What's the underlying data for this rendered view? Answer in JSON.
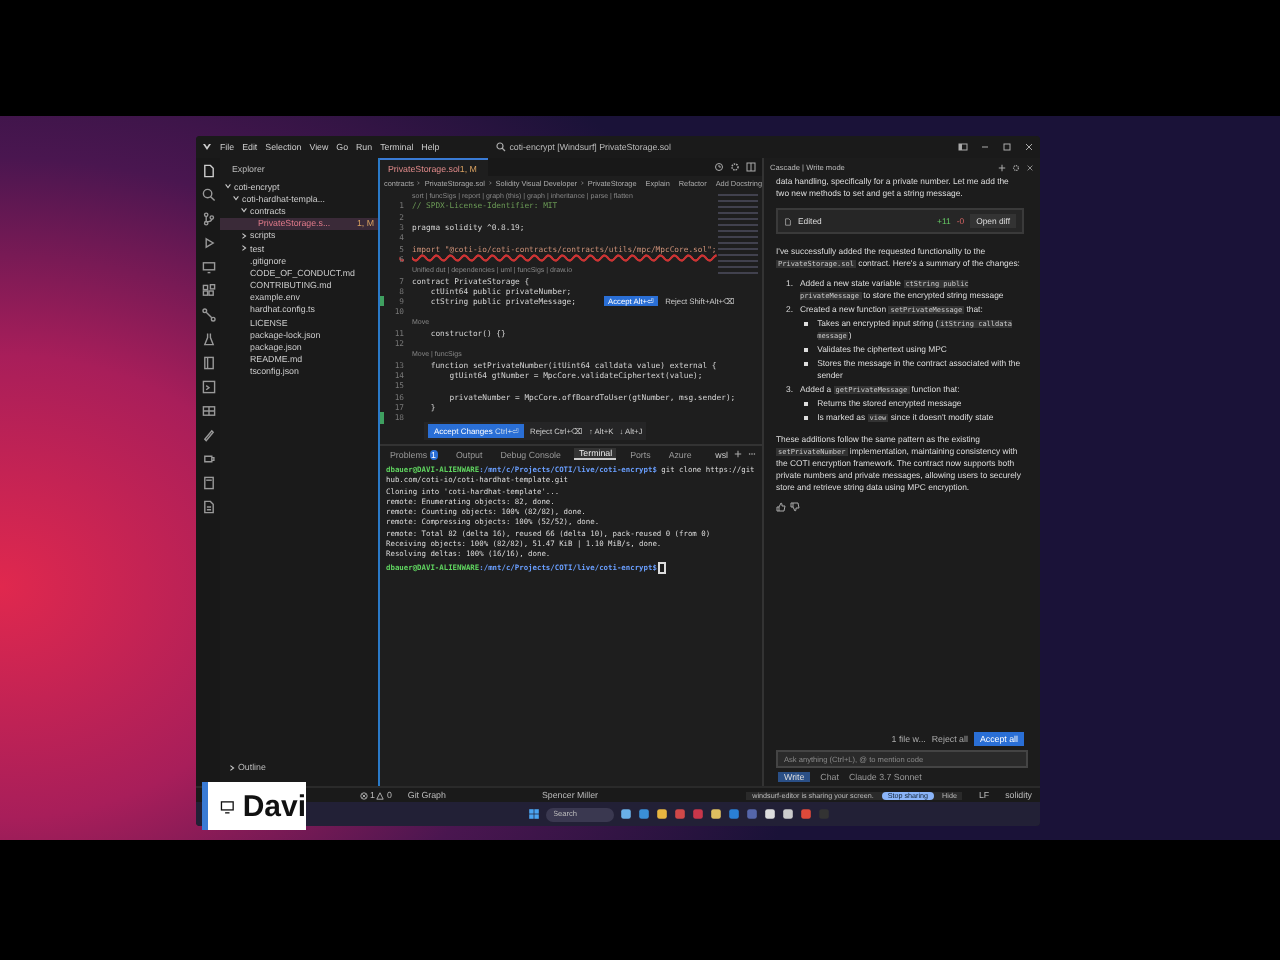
{
  "menu": [
    "File",
    "Edit",
    "Selection",
    "View",
    "Go",
    "Run",
    "Terminal",
    "Help"
  ],
  "command_center": "coti-encrypt [Windsurf] PrivateStorage.sol",
  "explorer": {
    "title": "Explorer",
    "tree": [
      {
        "label": "coti-encrypt",
        "expanded": true,
        "children": [
          {
            "label": "coti-hardhat-templa...",
            "expanded": true,
            "children": [
              {
                "label": "contracts",
                "expanded": true,
                "children": [
                  {
                    "label": "PrivateStorage.s...",
                    "badge": "1, M",
                    "selected": true
                  }
                ]
              },
              {
                "label": "scripts",
                "expanded": false
              },
              {
                "label": "test",
                "expanded": false
              },
              {
                "label": ".gitignore",
                "selected": false
              },
              {
                "label": "CODE_OF_CONDUCT.md",
                "selected": false
              },
              {
                "label": "CONTRIBUTING.md",
                "selected": false
              },
              {
                "label": "example.env",
                "selected": false
              },
              {
                "label": "hardhat.config.ts",
                "selected": false
              },
              {
                "label": "LICENSE",
                "selected": false
              },
              {
                "label": "package-lock.json",
                "selected": false
              },
              {
                "label": "package.json",
                "selected": false
              },
              {
                "label": "README.md",
                "selected": false
              },
              {
                "label": "tsconfig.json",
                "selected": false
              }
            ]
          }
        ]
      }
    ],
    "outline": "Outline"
  },
  "editor": {
    "tab": {
      "label": "PrivateStorage.sol",
      "badge": "1, M"
    },
    "breadcrumbs": [
      "contracts",
      "PrivateStorage.sol",
      "Solidity Visual Developer",
      "PrivateStorage"
    ],
    "actions": [
      "Explain",
      "Refactor",
      "Add Docstring"
    ],
    "lines": [
      {
        "kind": "lens",
        "text": "sort | funcSigs | report | graph (this) | graph | inheritance | parse | flatten"
      },
      {
        "kind": "comment",
        "num": "1",
        "text": "// SPDX-License-Identifier: MIT"
      },
      {
        "kind": "code",
        "num": "2"
      },
      {
        "kind": "code",
        "num": "3",
        "text": "pragma solidity ^0.8.19;"
      },
      {
        "kind": "code",
        "num": "4"
      },
      {
        "kind": "import",
        "num": "5",
        "text": "import \"@coti-io/coti-contracts/contracts/utils/mpc/MpcCore.sol\";"
      },
      {
        "kind": "code",
        "num": "6"
      },
      {
        "kind": "lens",
        "text": "Unified dut | dependencies | uml | funcSigs | draw.io"
      },
      {
        "kind": "code",
        "num": "7",
        "text": "contract PrivateStorage {"
      },
      {
        "kind": "code",
        "num": "8",
        "text": "    ctUint64 public privateNumber;"
      },
      {
        "kind": "code",
        "num": "9",
        "text": "    ctString public privateMessage;",
        "added": true,
        "inline_actions": [
          "Accept Alt+⏎",
          "Reject Shift+Alt+⌫"
        ]
      },
      {
        "kind": "code",
        "num": "10"
      },
      {
        "kind": "lens",
        "text": "Move"
      },
      {
        "kind": "code",
        "num": "11",
        "text": "    constructor() {}"
      },
      {
        "kind": "code",
        "num": "12"
      },
      {
        "kind": "lens",
        "text": "Move | funcSigs"
      },
      {
        "kind": "code",
        "num": "13",
        "text": "    function setPrivateNumber(itUint64 calldata value) external {"
      },
      {
        "kind": "code",
        "num": "14",
        "text": "        gtUint64 gtNumber = MpcCore.validateCiphertext(value);"
      },
      {
        "kind": "code",
        "num": "15"
      },
      {
        "kind": "code",
        "num": "16",
        "text": "        privateNumber = MpcCore.offBoardToUser(gtNumber, msg.sender);"
      },
      {
        "kind": "code",
        "num": "17",
        "text": "    }"
      },
      {
        "kind": "code",
        "num": "18",
        "added": true
      }
    ],
    "change_bar": {
      "accept": "Accept Changes",
      "accept_key": "Ctrl+⏎",
      "reject": "Reject Ctrl+⌫",
      "prev": "↑ Alt+K",
      "next": "↓ Alt+J"
    }
  },
  "panel": {
    "tabs": [
      {
        "label": "Problems",
        "badge": "1",
        "selected": false
      },
      {
        "label": "Output",
        "selected": false
      },
      {
        "label": "Debug Console",
        "selected": false
      },
      {
        "label": "Terminal",
        "selected": true
      },
      {
        "label": "Ports",
        "selected": false
      },
      {
        "label": "Azure",
        "selected": false
      }
    ],
    "shell": "wsl",
    "terminal": [
      {
        "kind": "prompt",
        "prompt": "dbauer@DAVI-ALIENWARE",
        "path": ":/mnt/c/Projects/COTI/live/coti-encrypt$",
        "command": " git clone https://github.com/coti-io/coti-hardhat-template.git"
      },
      {
        "kind": "out",
        "text": "Cloning into 'coti-hardhat-template'..."
      },
      {
        "kind": "out",
        "text": "remote: Enumerating objects: 82, done."
      },
      {
        "kind": "out",
        "text": "remote: Counting objects: 100% (82/82), done."
      },
      {
        "kind": "out",
        "text": "remote: Compressing objects: 100% (52/52), done."
      },
      {
        "kind": "out",
        "text": "remote: Total 82 (delta 16), reused 66 (delta 10), pack-reused 0 (from 0)"
      },
      {
        "kind": "out",
        "text": "Receiving objects: 100% (82/82), 51.47 KiB | 1.10 MiB/s, done."
      },
      {
        "kind": "out",
        "text": "Resolving deltas: 100% (16/16), done."
      },
      {
        "kind": "prompt",
        "prompt": "dbauer@DAVI-ALIENWARE",
        "path": ":/mnt/c/Projects/COTI/live/coti-encrypt$",
        "cursor": true
      }
    ]
  },
  "chat": {
    "title": "Cascade | Write mode",
    "blocks": [
      {
        "kind": "p",
        "parts": [
          {
            "text": "data handling, specifically for a private number. Let me add the two new methods to set and get a string message."
          }
        ]
      },
      {
        "kind": "edit",
        "label": "Edited",
        "added": "+11",
        "removed": "-0",
        "action": "Open diff"
      },
      {
        "kind": "p",
        "parts": [
          {
            "text": "I've successfully added the requested functionality to the "
          },
          {
            "text": "PrivateStorage.sol",
            "code": true
          },
          {
            "text": " contract. Here's a summary of the changes:"
          }
        ]
      },
      {
        "kind": "ol",
        "items": [
          {
            "number": "1.",
            "parts": [
              {
                "text": "Added a new state variable "
              },
              {
                "text": "ctString public privateMessage",
                "code": true
              },
              {
                "text": " to store the encrypted string message"
              }
            ]
          },
          {
            "number": "2.",
            "parts": [
              {
                "text": "Created a new function "
              },
              {
                "text": "setPrivateMessage",
                "code": true
              },
              {
                "text": " that:"
              }
            ],
            "children": [
              {
                "parts": [
                  {
                    "text": "Takes an encrypted input string ("
                  },
                  {
                    "text": "itString calldata message",
                    "code": true
                  },
                  {
                    "text": ")"
                  }
                ]
              },
              {
                "parts": [
                  {
                    "text": "Validates the ciphertext using MPC"
                  }
                ]
              },
              {
                "parts": [
                  {
                    "text": "Stores the message in the contract associated with the sender"
                  }
                ]
              }
            ]
          },
          {
            "number": "3.",
            "parts": [
              {
                "text": "Added a "
              },
              {
                "text": "getPrivateMessage",
                "code": true
              },
              {
                "text": " function that:"
              }
            ],
            "children": [
              {
                "parts": [
                  {
                    "text": "Returns the stored encrypted message"
                  }
                ]
              },
              {
                "parts": [
                  {
                    "text": "Is marked as "
                  },
                  {
                    "text": "view",
                    "code": true
                  },
                  {
                    "text": " since it doesn't modify state"
                  }
                ]
              }
            ]
          }
        ]
      },
      {
        "kind": "p",
        "parts": [
          {
            "text": "These additions follow the same pattern as the existing "
          },
          {
            "text": "setPrivateNumber",
            "code": true
          },
          {
            "text": " implementation, maintaining consistency with the COTI encryption framework. The contract now supports both private numbers and private messages, allowing users to securely store and retrieve string data using MPC encryption."
          }
        ]
      }
    ],
    "files": "1 file w...",
    "reject_all": "Reject all",
    "accept_all": "Accept all",
    "input": {
      "placeholder": "Ask anything (Ctrl+L), @ to mention code"
    },
    "mode": "Write",
    "chat_tab": "Chat",
    "model": "Claude 3.7 Sonnet"
  },
  "status": {
    "errors": "1",
    "warnings": "0",
    "git_graph": "Git Graph",
    "user": "Spencer Miller",
    "eol": "LF",
    "language": "solidity"
  },
  "share_bar": {
    "text": "windsurf-editor is sharing your screen.",
    "stop": "Stop sharing",
    "hide": "Hide"
  },
  "taskbar": {
    "search": {
      "placeholder": "Search"
    }
  },
  "presenter": {
    "name": "Davi"
  }
}
